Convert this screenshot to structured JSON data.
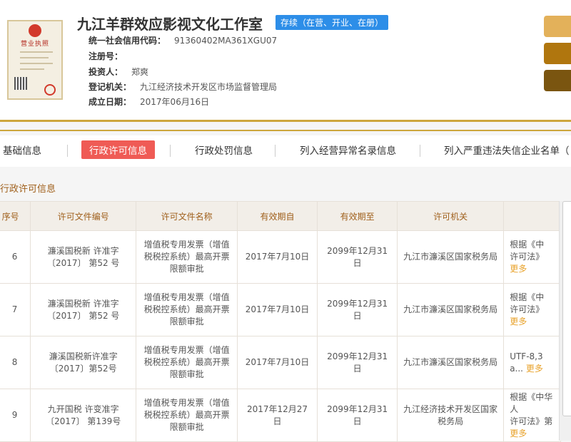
{
  "company": {
    "name": "九江羊群效应影视文化工作室",
    "status": "存续（在营、开业、在册）",
    "license_image_title": "营业执照"
  },
  "info": [
    {
      "key": "统一社会信用代码：",
      "value": "91360402MA361XGU07"
    },
    {
      "key": "注册号：",
      "value": ""
    },
    {
      "key": "投资人：",
      "value": "郑爽"
    },
    {
      "key": "登记机关：",
      "value": "九江经济技术开发区市场监督管理局"
    },
    {
      "key": "成立日期：",
      "value": "2017年06月16日"
    }
  ],
  "side_buttons": [
    "#e3b15a",
    "#b0760e",
    "#7a5510"
  ],
  "tabs": [
    "基础信息",
    "行政许可信息",
    "行政处罚信息",
    "列入经营异常名录信息",
    "列入严重违法失信企业名单（"
  ],
  "section_title": "行政许可信息",
  "table": {
    "headers": [
      "序号",
      "许可文件编号",
      "许可文件名称",
      "有效期自",
      "有效期至",
      "许可机关",
      ""
    ],
    "rows": [
      {
        "no": "6",
        "code": "濂溪国税新 许准字 〔2017〕 第52 号",
        "name": "增值税专用发票（增值税税控系统）最高开票限额审批",
        "from": "2017年7月10日",
        "to": "2099年12月31日",
        "org": "九江市濂溪区国家税务局",
        "extra": "根据《中",
        "extra2": "许可法》",
        "more": "更多"
      },
      {
        "no": "7",
        "code": "濂溪国税新 许准字 〔2017〕 第52 号",
        "name": "增值税专用发票（增值税税控系统）最高开票限额审批",
        "from": "2017年7月10日",
        "to": "2099年12月31日",
        "org": "九江市濂溪区国家税务局",
        "extra": "根据《中",
        "extra2": "许可法》",
        "more": "更多"
      },
      {
        "no": "8",
        "code": "濂溪国税新许准字〔2017〕第52号",
        "name": "增值税专用发票（增值税税控系统）最高开票限额审批",
        "from": "2017年7月10日",
        "to": "2099年12月31日",
        "org": "九江市濂溪区国家税务局",
        "extra": "UTF-8,3",
        "extra2": "a...",
        "more": "更多"
      },
      {
        "no": "9",
        "code": "九开国税 许变准字 〔2017〕 第139号",
        "name": "增值税专用发票（增值税税控系统）最高开票限额审批",
        "from": "2017年12月27日",
        "to": "2099年12月31日",
        "org": "九江经济技术开发区国家税务局",
        "extra": "根据《中华人",
        "extra2": "许可法》第",
        "more": "更多"
      }
    ]
  }
}
